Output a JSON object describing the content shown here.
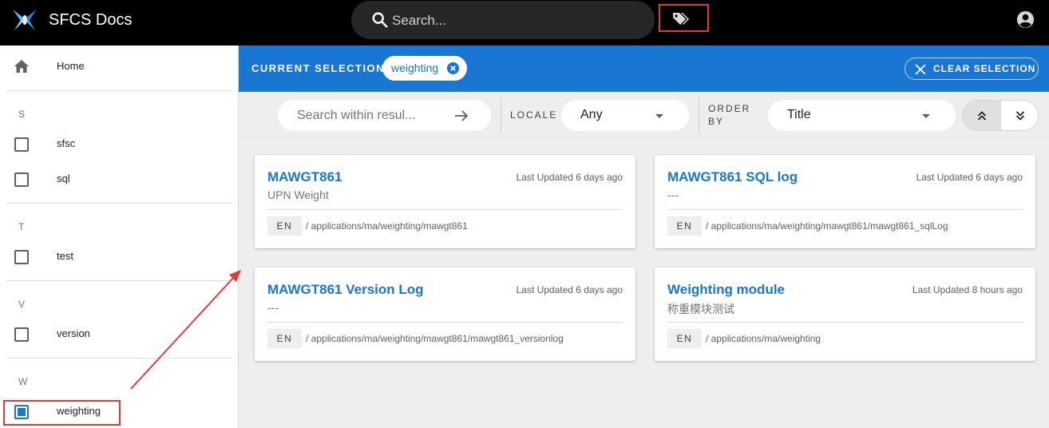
{
  "app": {
    "title": "SFCS Docs"
  },
  "search": {
    "placeholder": "Search..."
  },
  "sidebar": {
    "home_label": "Home",
    "groups": [
      {
        "letter": "S",
        "items": [
          "sfsc",
          "sql"
        ]
      },
      {
        "letter": "T",
        "items": [
          "test"
        ]
      },
      {
        "letter": "V",
        "items": [
          "version"
        ]
      },
      {
        "letter": "W",
        "items": [
          "weighting"
        ]
      }
    ],
    "checked_item": "weighting"
  },
  "selection": {
    "label": "CURRENT SELECTION",
    "chip": "weighting",
    "clear_label": "CLEAR SELECTION"
  },
  "filters": {
    "search_placeholder": "Search within resul...",
    "locale_label": "LOCALE",
    "locale_value": "Any",
    "order_label_1": "ORDER",
    "order_label_2": "BY",
    "order_value": "Title"
  },
  "cards": [
    {
      "title": "MAWGT861",
      "subtitle": "UPN Weight",
      "updated": "Last Updated 6 days ago",
      "lang": "EN",
      "path": "/ applications/ma/weighting/mawgt861"
    },
    {
      "title": "MAWGT861 SQL log",
      "subtitle": "---",
      "updated": "Last Updated 6 days ago",
      "lang": "EN",
      "path": "/ applications/ma/weighting/mawgt861/mawgt861_sqlLog"
    },
    {
      "title": "MAWGT861 Version Log",
      "subtitle": "---",
      "updated": "Last Updated 6 days ago",
      "lang": "EN",
      "path": "/ applications/ma/weighting/mawgt861/mawgt861_versionlog"
    },
    {
      "title": "Weighting module",
      "subtitle": "称重模块测试",
      "updated": "Last Updated 8 hours ago",
      "lang": "EN",
      "path": "/ applications/ma/weighting"
    }
  ],
  "colors": {
    "primary": "#1976d2",
    "topbar": "#000000",
    "highlight": "#e53935"
  }
}
